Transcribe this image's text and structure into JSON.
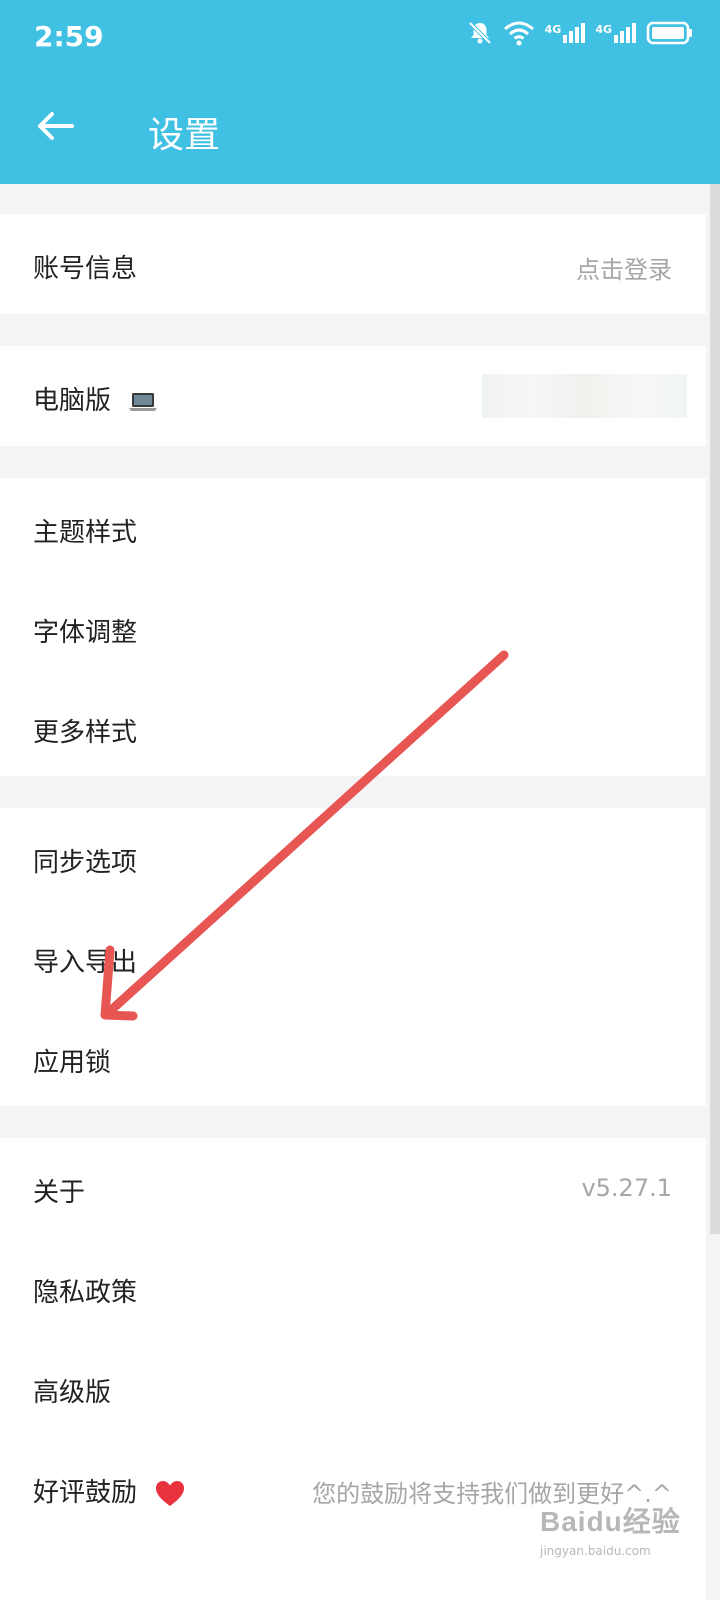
{
  "status_bar": {
    "time": "2:59",
    "icons": [
      "bell-mute-icon",
      "wifi-icon",
      "signal-4g-icon",
      "signal-4g-icon",
      "battery-icon"
    ],
    "network_label_1": "4G",
    "network_label_2": "4G"
  },
  "toolbar": {
    "back_icon": "arrow-left-icon",
    "title": "设置"
  },
  "groups": [
    {
      "rows": [
        {
          "label": "账号信息",
          "value": "点击登录"
        }
      ]
    },
    {
      "rows": [
        {
          "label": "电脑版",
          "icon": "laptop-icon",
          "value": "(blurred)"
        }
      ]
    },
    {
      "rows": [
        {
          "label": "主题样式"
        },
        {
          "label": "字体调整"
        },
        {
          "label": "更多样式"
        }
      ]
    },
    {
      "rows": [
        {
          "label": "同步选项"
        },
        {
          "label": "导入导出"
        },
        {
          "label": "应用锁"
        }
      ]
    },
    {
      "rows": [
        {
          "label": "关于",
          "value": "v5.27.1"
        },
        {
          "label": "隐私政策"
        },
        {
          "label": "高级版"
        },
        {
          "label": "好评鼓励",
          "icon": "heart-icon",
          "value": "您的鼓励将支持我们做到更好^.^"
        }
      ]
    }
  ],
  "annotation": {
    "color": "#e85654"
  },
  "watermark": {
    "main": "Baidu经验",
    "sub": "jingyan.baidu.com"
  },
  "colors": {
    "header": "#40c0e2",
    "background": "#f4f4f4",
    "value_text": "#a6a6a6"
  }
}
